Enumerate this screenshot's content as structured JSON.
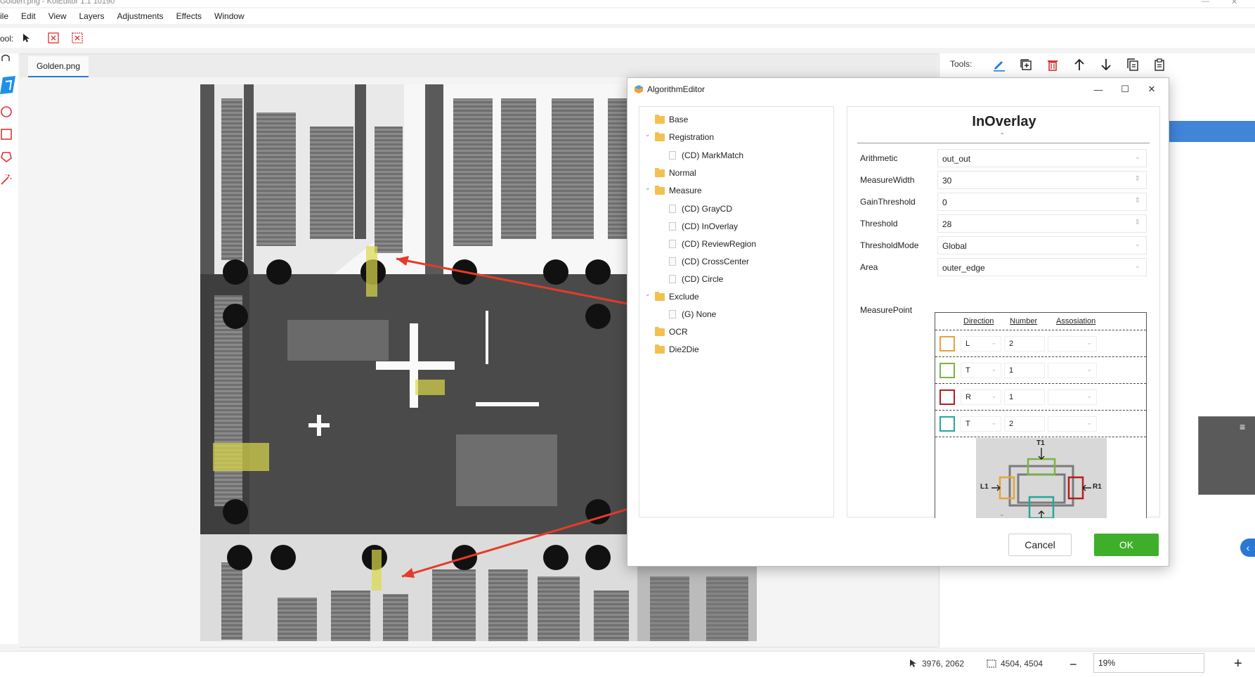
{
  "window": {
    "title": "Golden.png - KoiEditor 1.1 10190"
  },
  "menu": [
    "ile",
    "Edit",
    "View",
    "Layers",
    "Adjustments",
    "Effects",
    "Window"
  ],
  "toolbar": {
    "label": "ool:"
  },
  "document": {
    "tab": "Golden.png"
  },
  "right_panel": {
    "tools_label": "Tools:"
  },
  "dialog": {
    "title": "AlgorithmEditor",
    "tree": [
      {
        "label": "Base",
        "kind": "folder"
      },
      {
        "label": "Registration",
        "kind": "folder"
      },
      {
        "label": "(CD) MarkMatch",
        "kind": "file"
      },
      {
        "label": "Normal",
        "kind": "folder"
      },
      {
        "label": "Measure",
        "kind": "folder"
      },
      {
        "label": "(CD) GrayCD",
        "kind": "file"
      },
      {
        "label": "(CD) InOverlay",
        "kind": "file"
      },
      {
        "label": "(CD) ReviewRegion",
        "kind": "file"
      },
      {
        "label": "(CD) CrossCenter",
        "kind": "file"
      },
      {
        "label": "(CD) Circle",
        "kind": "file"
      },
      {
        "label": "Exclude",
        "kind": "folder"
      },
      {
        "label": "(G) None",
        "kind": "file"
      },
      {
        "label": "OCR",
        "kind": "folder"
      },
      {
        "label": "Die2Die",
        "kind": "folder"
      }
    ],
    "props_title": "InOverlay",
    "props": [
      {
        "label": "Arithmetic",
        "value": "out_out"
      },
      {
        "label": "MeasureWidth",
        "value": "30"
      },
      {
        "label": "GainThreshold",
        "value": "0"
      },
      {
        "label": "Threshold",
        "value": "28"
      },
      {
        "label": "ThresholdMode",
        "value": "Global"
      },
      {
        "label": "Area",
        "value": "outer_edge"
      }
    ],
    "measure_point": {
      "label": "MeasurePoint",
      "headers": [
        "Direction",
        "Number",
        "Assosiation"
      ],
      "rows": [
        {
          "color": "#e8a33a",
          "direction": "L",
          "number": "2"
        },
        {
          "color": "#7cb342",
          "direction": "T",
          "number": "1"
        },
        {
          "color": "#b71c1c",
          "direction": "R",
          "number": "1"
        },
        {
          "color": "#26a69a",
          "direction": "T",
          "number": "2"
        }
      ],
      "diagram_labels": {
        "top": "T1",
        "left": "L1",
        "right": "R1"
      }
    },
    "cancel": "Cancel",
    "ok": "OK"
  },
  "status": {
    "cursor": "3976, 2062",
    "size": "4504, 4504",
    "zoom": "19%"
  },
  "colors": {
    "accent": "#2b78d4",
    "ok": "#3fae2a",
    "arrow": "#e53b2a",
    "highlight": "#dcd84a"
  }
}
